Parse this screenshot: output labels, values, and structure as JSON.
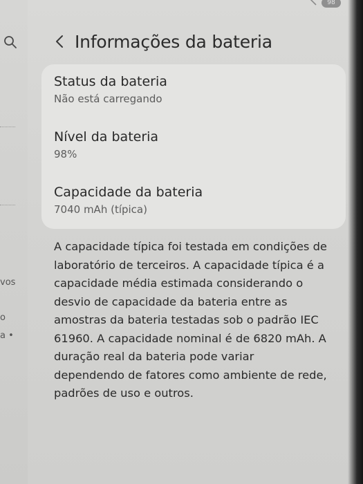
{
  "status_bar": {
    "battery_level": "98"
  },
  "left_pane": {
    "snippets": [
      "vos",
      "o",
      "a •"
    ]
  },
  "header": {
    "title": "Informações da bateria"
  },
  "battery_info": {
    "items": [
      {
        "label": "Status da bateria",
        "value": "Não está carregando"
      },
      {
        "label": "Nível da bateria",
        "value": "98%"
      },
      {
        "label": "Capacidade da bateria",
        "value": "7040 mAh (típica)"
      }
    ]
  },
  "description": "A capacidade típica foi testada em condições de laboratório de terceiros. A capacidade típica é a capacidade média estimada considerando o desvio de capacidade da bateria entre as amostras da bateria testadas sob o padrão IEC 61960. A capacidade nominal é de 6820 mAh. A duração real da bateria pode variar dependendo de fatores como ambiente de rede, padrões de uso e outros.",
  "colors": {
    "background": "#d6d6d4",
    "card": "#e4e4e2",
    "text_primary": "#2b2b2b",
    "text_secondary": "#5c5c5c"
  }
}
